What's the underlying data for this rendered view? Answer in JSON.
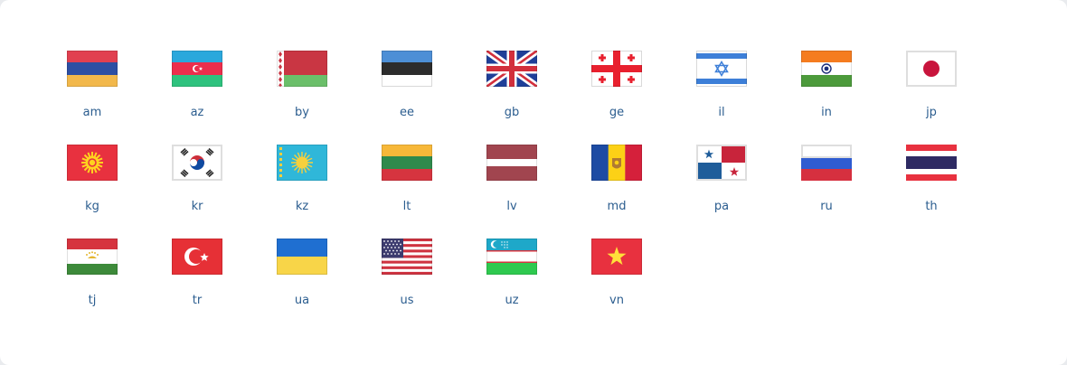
{
  "flags": [
    {
      "code": "am",
      "icon": "armenia-flag-icon"
    },
    {
      "code": "az",
      "icon": "azerbaijan-flag-icon"
    },
    {
      "code": "by",
      "icon": "belarus-flag-icon"
    },
    {
      "code": "ee",
      "icon": "estonia-flag-icon"
    },
    {
      "code": "gb",
      "icon": "united-kingdom-flag-icon"
    },
    {
      "code": "ge",
      "icon": "georgia-flag-icon"
    },
    {
      "code": "il",
      "icon": "israel-flag-icon"
    },
    {
      "code": "in",
      "icon": "india-flag-icon"
    },
    {
      "code": "jp",
      "icon": "japan-flag-icon"
    },
    {
      "code": "kg",
      "icon": "kyrgyzstan-flag-icon"
    },
    {
      "code": "kr",
      "icon": "south-korea-flag-icon"
    },
    {
      "code": "kz",
      "icon": "kazakhstan-flag-icon"
    },
    {
      "code": "lt",
      "icon": "lithuania-flag-icon"
    },
    {
      "code": "lv",
      "icon": "latvia-flag-icon"
    },
    {
      "code": "md",
      "icon": "moldova-flag-icon"
    },
    {
      "code": "pa",
      "icon": "panama-flag-icon"
    },
    {
      "code": "ru",
      "icon": "russia-flag-icon"
    },
    {
      "code": "th",
      "icon": "thailand-flag-icon"
    },
    {
      "code": "tj",
      "icon": "tajikistan-flag-icon"
    },
    {
      "code": "tr",
      "icon": "turkey-flag-icon"
    },
    {
      "code": "ua",
      "icon": "ukraine-flag-icon"
    },
    {
      "code": "us",
      "icon": "united-states-flag-icon"
    },
    {
      "code": "uz",
      "icon": "uzbekistan-flag-icon"
    },
    {
      "code": "vn",
      "icon": "vietnam-flag-icon"
    }
  ],
  "colors": {
    "label": "#2b5d8f",
    "panel": "#ffffff",
    "page": "#e9ebee"
  }
}
